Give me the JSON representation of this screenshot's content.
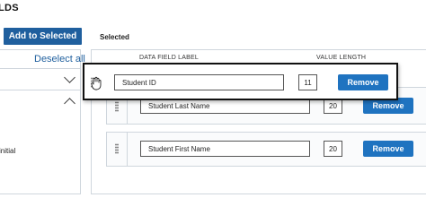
{
  "header": {
    "title": "LDS"
  },
  "toolbar": {
    "add_label": "Add to Selected",
    "selected_label": "Selected"
  },
  "left_panel": {
    "deselect_label": "Deselect all",
    "partial_item": "initial"
  },
  "columns": {
    "field_label": "DATA FIELD LABEL",
    "value_length": "VALUE LENGTH"
  },
  "rows": [
    {
      "label": "Student ID",
      "length": "11",
      "remove_label": "Remove",
      "state": "dragging"
    },
    {
      "label": "Student Last Name",
      "length": "20",
      "remove_label": "Remove"
    },
    {
      "label": "Student First Name",
      "length": "20",
      "remove_label": "Remove"
    }
  ],
  "icons": {
    "collapse_1": "chevron-down-icon",
    "collapse_2": "chevron-up-icon",
    "drag": "grip-dots-icon",
    "cursor": "grab-hand-cursor-icon"
  },
  "colors": {
    "primary": "#1f5f9e",
    "button": "#1f73c0",
    "border": "#cfd6dd"
  }
}
